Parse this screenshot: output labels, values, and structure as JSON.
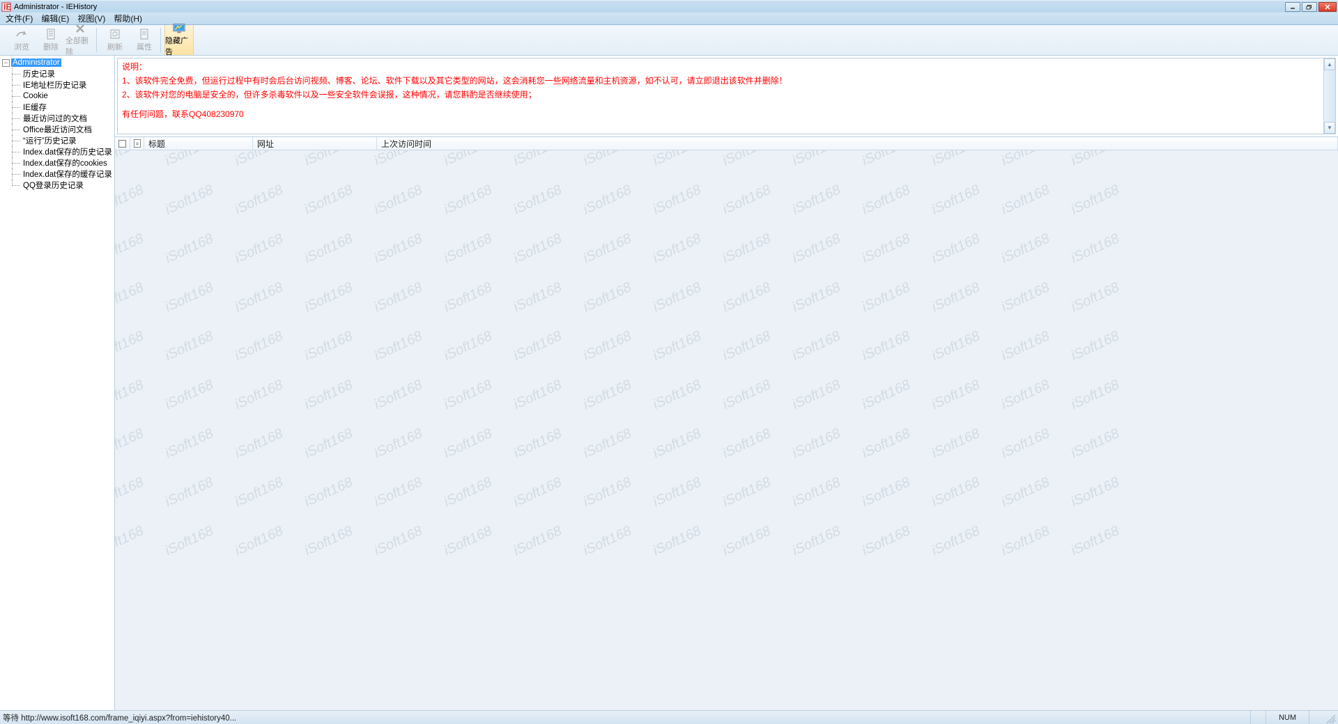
{
  "window": {
    "title": "Administrator - IEHistory"
  },
  "menu": {
    "file": "文件(F)",
    "edit": "编辑(E)",
    "view": "视图(V)",
    "help": "帮助(H)"
  },
  "toolbar": {
    "browse": "浏览",
    "delete": "删除",
    "delete_all": "全部删除",
    "refresh": "刷新",
    "properties": "属性",
    "hide_ads": "隐藏广告"
  },
  "tree": {
    "root": "Administrator",
    "items": [
      "历史记录",
      "IE地址栏历史记录",
      "Cookie",
      "IE缓存",
      "最近访问过的文档",
      "Office最近访问文档",
      "“运行”历史记录",
      "Index.dat保存的历史记录",
      "Index.dat保存的cookies",
      "Index.dat保存的缓存记录",
      "QQ登录历史记录"
    ]
  },
  "notice": {
    "heading": "说明：",
    "line1": "1、该软件完全免费，但运行过程中有时会后台访问视频、博客、论坛、软件下载以及其它类型的网站，这会消耗您一些网络流量和主机资源，如不认可，请立即退出该软件并删除！",
    "line2": "2、该软件对您的电脑是安全的，但许多杀毒软件以及一些安全软件会误报，这种情况，请您斟酌是否继续使用；",
    "contact": "有任何问题，联系QQ408230970"
  },
  "list": {
    "columns": {
      "title": "标题",
      "url": "网址",
      "last_visit": "上次访问时间"
    }
  },
  "watermark_text": "iSoft168",
  "status": {
    "left": "等待 http://www.isoft168.com/frame_iqiyi.aspx?from=iehistory40...",
    "num": "NUM"
  }
}
